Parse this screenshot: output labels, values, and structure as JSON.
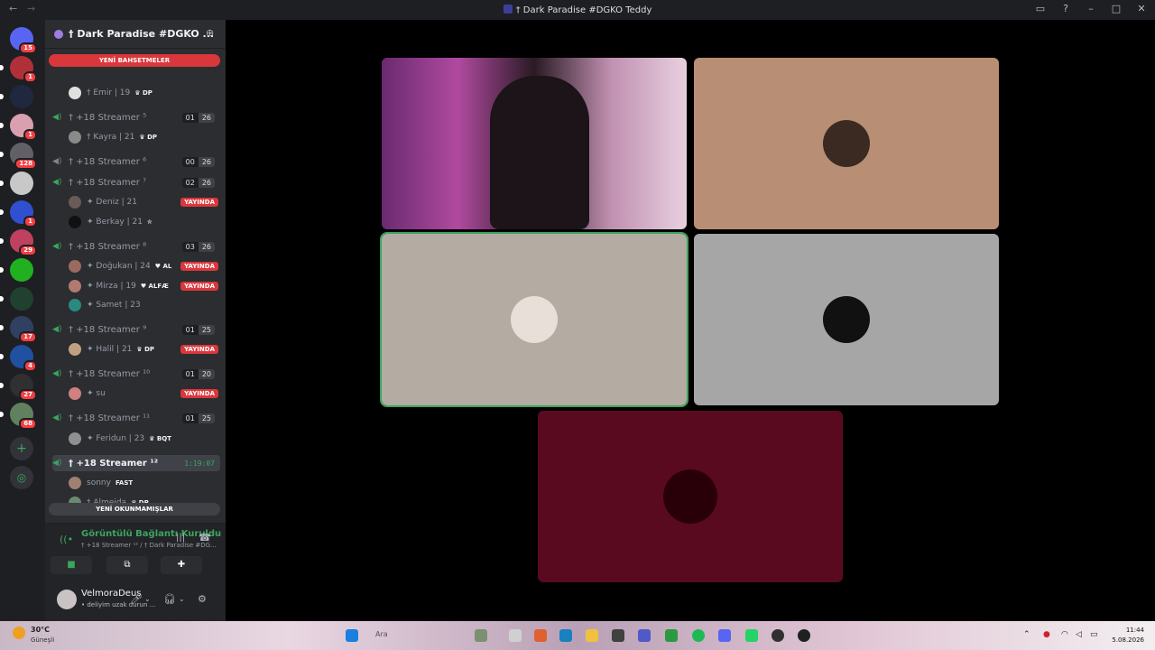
{
  "window": {
    "title": "† Dark Paradise #DGKO Teddy",
    "back": "←",
    "forward": "→",
    "controls": [
      "▭",
      "?",
      "–",
      "□",
      "✕"
    ]
  },
  "servers": [
    {
      "name": "discord-home",
      "color": "#5865f2",
      "badge": "15"
    },
    {
      "name": "server-red",
      "color": "#b0303a",
      "badge": "1"
    },
    {
      "name": "server-dark",
      "color": "#202840",
      "badge": ""
    },
    {
      "name": "server-pink",
      "color": "#d9a0b0",
      "badge": "1"
    },
    {
      "name": "server-gray",
      "color": "#606066",
      "badge": "128"
    },
    {
      "name": "server-deus",
      "color": "#c8c8c8",
      "badge": ""
    },
    {
      "name": "server-lc",
      "color": "#3050d0",
      "badge": "1"
    },
    {
      "name": "server-rose",
      "color": "#c04060",
      "badge": "29"
    },
    {
      "name": "server-kick",
      "color": "#20b020",
      "badge": ""
    },
    {
      "name": "server-moon",
      "color": "#204030",
      "badge": ""
    },
    {
      "name": "server-blue",
      "color": "#304060",
      "badge": "17"
    },
    {
      "name": "server-dcflow",
      "color": "#2050a0",
      "badge": "4"
    },
    {
      "name": "server-qr",
      "color": "#303030",
      "badge": "27"
    },
    {
      "name": "server-group",
      "color": "#608060",
      "badge": "68"
    }
  ],
  "server_actions": {
    "add": "+",
    "discover": "◎"
  },
  "guild": {
    "name": "† Dark Paradise #DGKO ...",
    "chevron": "⌄",
    "invite": "⊕"
  },
  "mentions_pill": "YENİ BAHSETMELER",
  "unread_pill": "YENİ OKUNMAMIŞLAR",
  "channels": [
    {
      "name": "† +18 Streamer ⁵",
      "a": "01",
      "b": "26",
      "muted": false
    },
    {
      "name": "† +18 Streamer ⁶",
      "a": "00",
      "b": "26",
      "muted": true
    },
    {
      "name": "† +18 Streamer ⁷",
      "a": "02",
      "b": "26",
      "muted": false
    },
    {
      "name": "† +18 Streamer ⁸",
      "a": "03",
      "b": "26",
      "muted": false
    },
    {
      "name": "† +18 Streamer ⁹",
      "a": "01",
      "b": "25",
      "muted": false
    },
    {
      "name": "† +18 Streamer ¹⁰",
      "a": "01",
      "b": "20",
      "muted": false
    },
    {
      "name": "† +18 Streamer ¹¹",
      "a": "01",
      "b": "25",
      "muted": false
    },
    {
      "name": "† +18 Streamer ¹²",
      "timer": "1:19:07",
      "active": true
    }
  ],
  "users": [
    {
      "name": "† Emir | 19",
      "tag": "♛ DP",
      "live": ""
    },
    {
      "name": "† Kayra | 21",
      "tag": "♛ DP",
      "live": ""
    },
    {
      "name": "✦ Deniz | 21",
      "tag": "",
      "live": "YAYINDA"
    },
    {
      "name": "✦ Berkay | 21",
      "tag": "✮",
      "live": ""
    },
    {
      "name": "✦ Doğukan | 24",
      "tag": "♥ AL",
      "live": "YAYINDA"
    },
    {
      "name": "✦ Mirza | 19",
      "tag": "♥ ALFÆ",
      "live": "YAYINDA"
    },
    {
      "name": "✦ Samet | 23",
      "tag": "",
      "live": ""
    },
    {
      "name": "✦ Halil | 21",
      "tag": "♛ DP",
      "live": "YAYINDA"
    },
    {
      "name": "✦ su",
      "tag": "",
      "live": "YAYINDA"
    },
    {
      "name": "✦ Feridun | 23",
      "tag": "♛ BQT",
      "live": ""
    },
    {
      "name": "sonny",
      "tag": "FAST",
      "live": ""
    },
    {
      "name": "† Almeida",
      "tag": "♛ DP",
      "live": ""
    }
  ],
  "rtc": {
    "status": "Görüntülü Bağlantı Kuruldu",
    "location": "† +18 Streamer ¹² / † Dark Paradise #DG...",
    "signal": "((•",
    "wave": "|||",
    "hangup": "☎",
    "camera": "■",
    "share": "⧉",
    "activity": "✚"
  },
  "user_panel": {
    "name": "VelmoraDeus",
    "status": "• deliyim uzak durun ...",
    "mic": "🎤︎",
    "headset": "🎧︎",
    "settings": "⚙",
    "chevron": "⌄"
  },
  "video_tiles": [
    {
      "name": "tile-camera",
      "bg": "#8a3a80",
      "speaking": false
    },
    {
      "name": "tile-peach",
      "bg": "#b88f74",
      "speaking": false
    },
    {
      "name": "tile-beige",
      "bg": "#b4aca2",
      "speaking": true
    },
    {
      "name": "tile-gray",
      "bg": "#a6a6a6",
      "speaking": false
    },
    {
      "name": "tile-crimson",
      "bg": "#5a0a1e",
      "speaking": false
    }
  ],
  "taskbar": {
    "temp": "30°C",
    "weather": "Güneşli",
    "search": "Ara",
    "time": "11:44",
    "date": "5.08.2026",
    "tray_up": "⌃"
  }
}
